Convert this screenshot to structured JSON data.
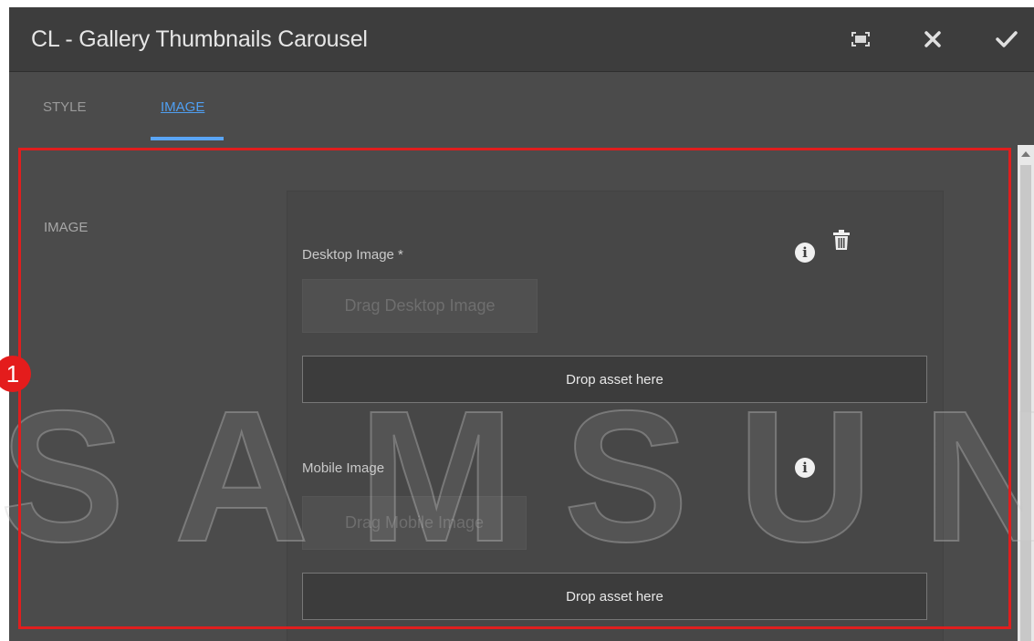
{
  "dialog": {
    "title": "CL - Gallery Thumbnails Carousel",
    "buttons": {
      "fullscreen": "fullscreen-icon",
      "close": "close-icon",
      "confirm": "check-icon"
    }
  },
  "tabs": [
    {
      "label": "STYLE",
      "active": false
    },
    {
      "label": "IMAGE",
      "active": true
    }
  ],
  "section": {
    "label": "IMAGE"
  },
  "fields": {
    "desktop": {
      "label": "Desktop Image *",
      "drag_label": "Drag Desktop Image",
      "drop_label": "Drop asset here"
    },
    "mobile": {
      "label": "Mobile Image",
      "drag_label": "Drag Mobile Image",
      "drop_label": "Drop asset here"
    }
  },
  "annotation": {
    "marker": "1",
    "color": "#e01e1e"
  },
  "watermark": {
    "text": "SAMSUNG"
  },
  "colors": {
    "accent": "#5aa5f5",
    "titlebar": "#3d3d3d",
    "panel": "#4b4b4b"
  }
}
